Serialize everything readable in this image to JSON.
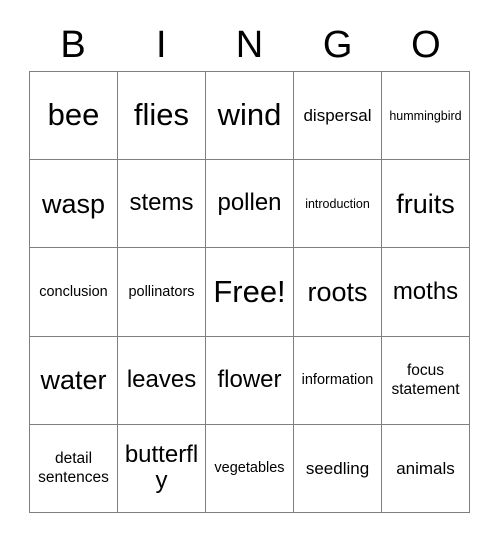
{
  "card": {
    "title": "BINGO",
    "header_letters": [
      "B",
      "I",
      "N",
      "G",
      "O"
    ],
    "columns": 5,
    "rows": 5,
    "border_color": "#7f7f7f",
    "background_color": "#ffffff",
    "text_color": "#000000",
    "free_space": {
      "row": 3,
      "column": 3,
      "label": "Free!"
    },
    "cells": [
      [
        {
          "text": "bee",
          "size": "xl"
        },
        {
          "text": "flies",
          "size": "xl"
        },
        {
          "text": "wind",
          "size": "xl"
        },
        {
          "text": "dispersal",
          "size": "sm"
        },
        {
          "text": "hummingbird",
          "size": "xxs"
        }
      ],
      [
        {
          "text": "wasp",
          "size": "lg"
        },
        {
          "text": "stems",
          "size": "md"
        },
        {
          "text": "pollen",
          "size": "md"
        },
        {
          "text": "introduction",
          "size": "xxs"
        },
        {
          "text": "fruits",
          "size": "lg"
        }
      ],
      [
        {
          "text": "conclusion",
          "size": "xs"
        },
        {
          "text": "pollinators",
          "size": "xs"
        },
        {
          "text": "Free!",
          "size": "xl"
        },
        {
          "text": "roots",
          "size": "lg"
        },
        {
          "text": "moths",
          "size": "md"
        }
      ],
      [
        {
          "text": "water",
          "size": "lg"
        },
        {
          "text": "leaves",
          "size": "md"
        },
        {
          "text": "flower",
          "size": "md"
        },
        {
          "text": "information",
          "size": "xs"
        },
        {
          "text": "focus\nstatement",
          "size": "two"
        }
      ],
      [
        {
          "text": "detail\nsentences",
          "size": "two"
        },
        {
          "text": "butterfly",
          "size": "md"
        },
        {
          "text": "vegetables",
          "size": "xs"
        },
        {
          "text": "seedling",
          "size": "sm"
        },
        {
          "text": "animals",
          "size": "sm"
        }
      ]
    ]
  }
}
